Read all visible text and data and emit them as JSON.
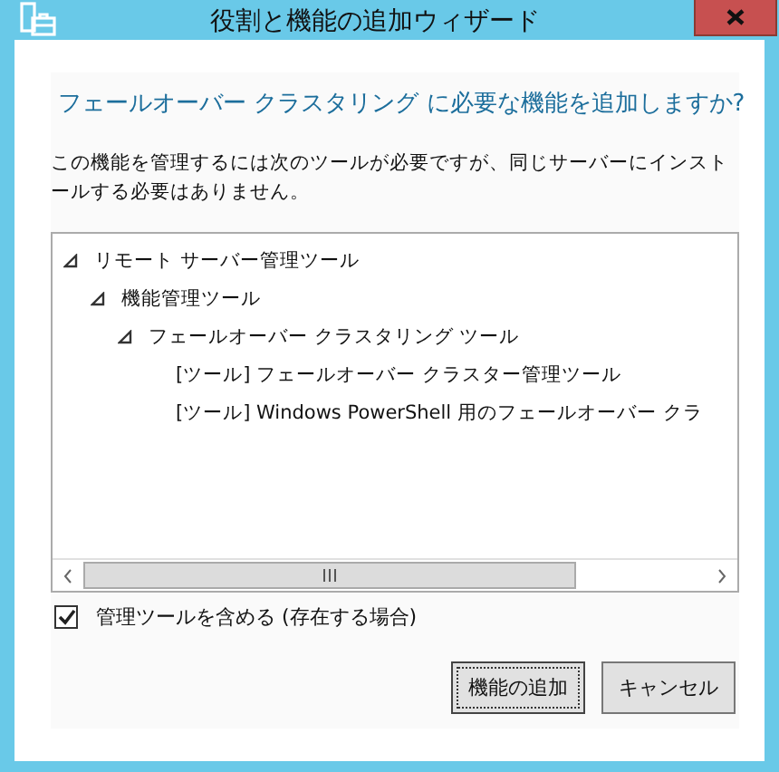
{
  "window": {
    "title": "役割と機能の追加ウィザード"
  },
  "heading": "フェールオーバー クラスタリング に必要な機能を追加しますか?",
  "description": "この機能を管理するには次のツールが必要ですが、同じサーバーにインストールする必要はありません。",
  "tree": [
    {
      "label": "リモート サーバー管理ツール",
      "expanded": true,
      "children": [
        {
          "label": "機能管理ツール",
          "expanded": true,
          "children": [
            {
              "label": "フェールオーバー クラスタリング ツール",
              "expanded": true,
              "children": [
                {
                  "label": "[ツール] フェールオーバー クラスター管理ツール"
                },
                {
                  "label": "[ツール] Windows PowerShell 用のフェールオーバー クラ"
                }
              ]
            }
          ]
        }
      ]
    }
  ],
  "include_tools": {
    "label": "管理ツールを含める (存在する場合)",
    "checked": true
  },
  "buttons": [
    {
      "label": "機能の追加",
      "focused": true
    },
    {
      "label": "キャンセル",
      "focused": false
    }
  ]
}
